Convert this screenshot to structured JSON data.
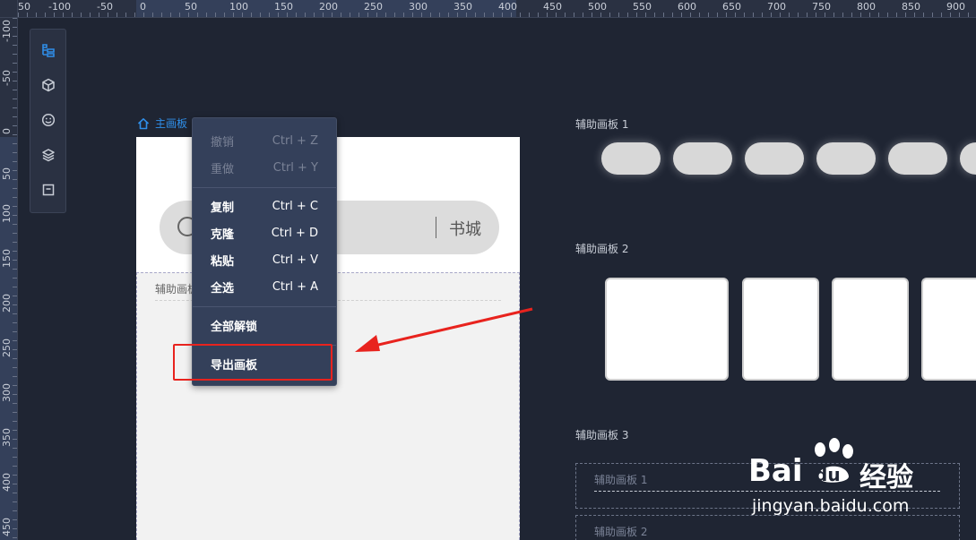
{
  "ruler": {
    "x_ticks": [
      "50",
      "-100",
      "-50",
      "0",
      "50",
      "100",
      "150",
      "200",
      "250",
      "300",
      "350",
      "400",
      "450",
      "500",
      "550",
      "600",
      "650",
      "700",
      "750",
      "800",
      "850",
      "900"
    ],
    "y_ticks": [
      "-100",
      "-50",
      "0",
      "50",
      "100",
      "150",
      "200",
      "250",
      "300",
      "350",
      "400",
      "450"
    ]
  },
  "toolbar": {
    "tools": [
      {
        "icon": "tree-structure-icon",
        "active": true
      },
      {
        "icon": "cube-icon",
        "active": false
      },
      {
        "icon": "smiley-icon",
        "active": false
      },
      {
        "icon": "layers-icon",
        "active": false
      },
      {
        "icon": "artboard-icon",
        "active": false
      }
    ]
  },
  "artboard": {
    "breadcrumb": "主画板",
    "search_action": "书城",
    "aux_region_label": "辅助画板"
  },
  "context_menu": {
    "items": [
      {
        "label": "撤销",
        "shortcut": "Ctrl + Z",
        "disabled": true
      },
      {
        "label": "重做",
        "shortcut": "Ctrl + Y",
        "disabled": true
      },
      {
        "label": "复制",
        "shortcut": "Ctrl + C",
        "disabled": false
      },
      {
        "label": "克隆",
        "shortcut": "Ctrl + D",
        "disabled": false
      },
      {
        "label": "粘贴",
        "shortcut": "Ctrl + V",
        "disabled": false
      },
      {
        "label": "全选",
        "shortcut": "Ctrl + A",
        "disabled": false
      },
      {
        "label": "全部解锁",
        "shortcut": "",
        "disabled": false
      },
      {
        "label": "导出画板",
        "shortcut": "",
        "disabled": false
      }
    ]
  },
  "aux_boards": {
    "board1_title": "辅助画板 1",
    "board2_title": "辅助画板 2",
    "board3_title": "辅助画板 3",
    "board3_rows": [
      "辅助画板 1",
      "辅助画板 2"
    ]
  },
  "watermark": {
    "brand": "Bai",
    "brand_du": "du",
    "cn": "经验",
    "url": "jingyan.baidu.com"
  },
  "colors": {
    "background": "#1f2533",
    "accent": "#2f8ee8",
    "annotation": "#e8231e",
    "menu_bg": "#34405a"
  }
}
